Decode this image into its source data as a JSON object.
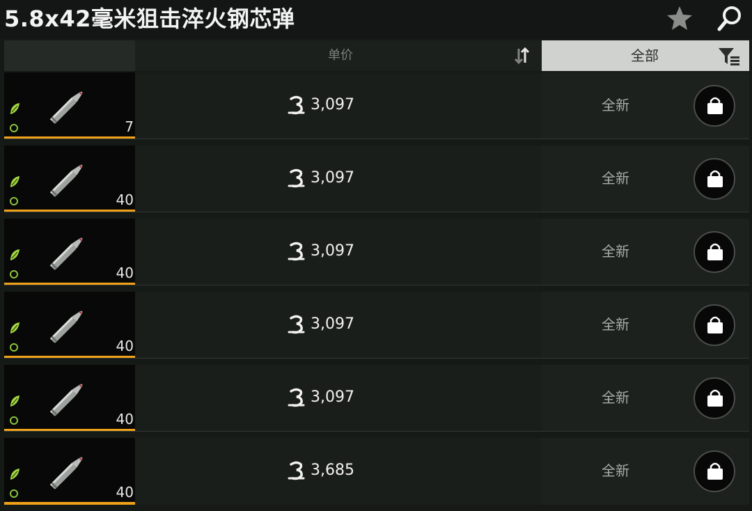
{
  "header": {
    "title": "5.8x42毫米狙击淬火钢芯弹",
    "icons": [
      "star-icon",
      "search-icon"
    ]
  },
  "table_header": {
    "price_label": "单价",
    "filter_label": "全部",
    "icons": [
      "sort-icon",
      "filter-icon"
    ]
  },
  "listings": [
    {
      "quantity": "7",
      "price": "3,097",
      "condition": "全新"
    },
    {
      "quantity": "40",
      "price": "3,097",
      "condition": "全新"
    },
    {
      "quantity": "40",
      "price": "3,097",
      "condition": "全新"
    },
    {
      "quantity": "40",
      "price": "3,097",
      "condition": "全新"
    },
    {
      "quantity": "40",
      "price": "3,097",
      "condition": "全新"
    },
    {
      "quantity": "40",
      "price": "3,685",
      "condition": "全新"
    }
  ],
  "colors": {
    "accent_orange": "#f0a21a",
    "leaf_green": "#8cc43c",
    "header_tab_bg": "#cfd2cf"
  }
}
